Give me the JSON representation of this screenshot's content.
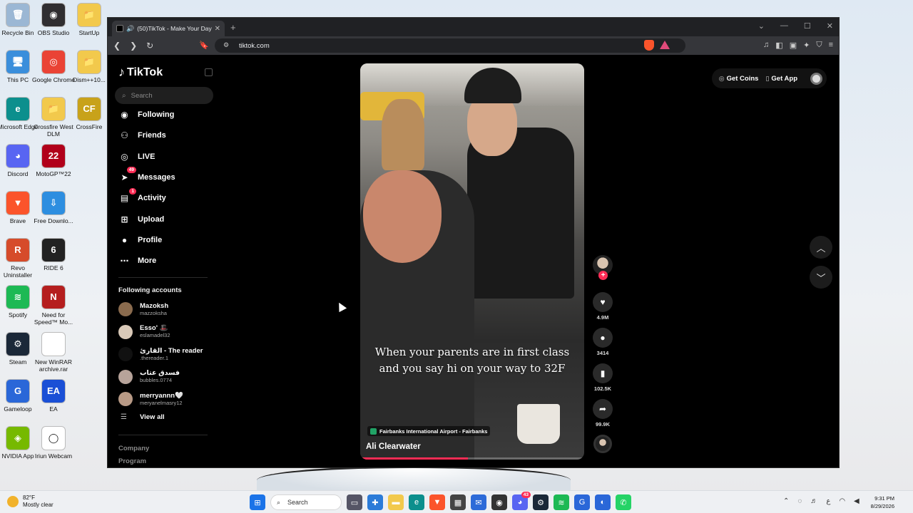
{
  "desktop": {
    "icons": [
      {
        "label": "Recycle Bin",
        "color": "#9bb7d4",
        "glyph": "🗑"
      },
      {
        "label": "OBS Studio",
        "color": "#302e31",
        "glyph": "◉"
      },
      {
        "label": "StartUp",
        "color": "#f2c94c",
        "glyph": "📁"
      },
      {
        "label": "This PC",
        "color": "#3a8edb",
        "glyph": "🖥"
      },
      {
        "label": "Google Chrome",
        "color": "#ea4335",
        "glyph": "◎"
      },
      {
        "label": "Dism++10...",
        "color": "#f2c94c",
        "glyph": "📁"
      },
      {
        "label": "Microsoft Edge",
        "color": "#0c8f8d",
        "glyph": "e"
      },
      {
        "label": "Crossfire West DLM",
        "color": "#f2c94c",
        "glyph": "📁"
      },
      {
        "label": "CrossFire",
        "color": "#c8a21a",
        "glyph": "CF"
      },
      {
        "label": "Discord",
        "color": "#5865f2",
        "glyph": "◕"
      },
      {
        "label": "MotoGP™22",
        "color": "#b1001a",
        "glyph": "22"
      },
      {
        "label": "Brave",
        "color": "#fb542b",
        "glyph": "▼"
      },
      {
        "label": "Free Downlo...",
        "color": "#2d8ee0",
        "glyph": "⇩"
      },
      {
        "label": "Revo Uninstaller",
        "color": "#d64b2a",
        "glyph": "R"
      },
      {
        "label": "RIDE 6",
        "color": "#222222",
        "glyph": "6"
      },
      {
        "label": "Spotify",
        "color": "#1db954",
        "glyph": "≋"
      },
      {
        "label": "Need for Speed™ Mo...",
        "color": "#b51e1e",
        "glyph": "N"
      },
      {
        "label": "Steam",
        "color": "#1b2838",
        "glyph": "⚙"
      },
      {
        "label": "New WinRAR archive.rar",
        "color": "#ffffff",
        "glyph": ""
      },
      {
        "label": "Gameloop",
        "color": "#2a67d8",
        "glyph": "G"
      },
      {
        "label": "EA",
        "color": "#1a4fd6",
        "glyph": "EA"
      },
      {
        "label": "NVIDIA App",
        "color": "#76b900",
        "glyph": "◈"
      },
      {
        "label": "Iriun Webcam",
        "color": "#ffffff",
        "glyph": "◯"
      }
    ]
  },
  "browser": {
    "tab_title": "(50)TikTok - Make Your Day",
    "tab_audio_icon": "speaker-icon",
    "url": "tiktok.com"
  },
  "tiktok": {
    "logo_text": "TikTok",
    "search_placeholder": "Search",
    "nav": [
      {
        "label": "Following",
        "icon": "following-icon",
        "badge": ""
      },
      {
        "label": "Friends",
        "icon": "friends-icon",
        "badge": ""
      },
      {
        "label": "LIVE",
        "icon": "live-icon",
        "badge": ""
      },
      {
        "label": "Messages",
        "icon": "messages-icon",
        "badge": "49"
      },
      {
        "label": "Activity",
        "icon": "activity-icon",
        "badge": "1"
      },
      {
        "label": "Upload",
        "icon": "upload-icon",
        "badge": ""
      },
      {
        "label": "Profile",
        "icon": "profile-icon",
        "badge": ""
      },
      {
        "label": "More",
        "icon": "more-icon",
        "badge": ""
      }
    ],
    "following_title": "Following accounts",
    "accounts": [
      {
        "name": "Mazoksh",
        "handle": "mazzoksha",
        "color": "#8a6b4e"
      },
      {
        "name": "Esso' 🎩",
        "handle": "eslamadel32",
        "color": "#d9c9b8"
      },
      {
        "name": "القارئ - The reader",
        "handle": ".thereader.1",
        "color": "#111111"
      },
      {
        "name": "فسدق عتاب",
        "handle": "bubbles.0774",
        "color": "#b7a39a"
      },
      {
        "name": "merryannn🤍",
        "handle": "meryanelmasry12",
        "color": "#b89a86"
      }
    ],
    "view_all": "View all",
    "footer_links": [
      "Company",
      "Program"
    ],
    "get_coins": "Get Coins",
    "get_app": "Get App",
    "video": {
      "caption": "When your parents are in first class and you say hi on your way to 32F",
      "location": "Fairbanks International Airport - Fairbanks",
      "author": "Ali Clearwater",
      "progress": 0.48
    },
    "actions": {
      "likes": "4.9M",
      "comments": "3414",
      "saves": "102.5K",
      "shares": "99.9K"
    }
  },
  "taskbar": {
    "temperature": "82°F",
    "weather_text": "Mostly clear",
    "search_label": "Search",
    "time": "9:31 PM",
    "date": "8/29/2026",
    "discord_badge": "43"
  }
}
